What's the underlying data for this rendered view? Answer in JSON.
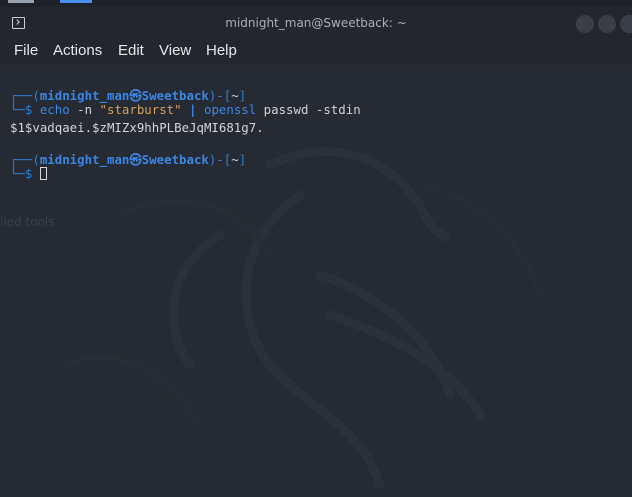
{
  "window": {
    "title": "midnight_man@Sweetback: ~"
  },
  "menu": {
    "items": [
      "File",
      "Actions",
      "Edit",
      "View",
      "Help"
    ]
  },
  "background_ghost_text": "lled tools",
  "prompt1": {
    "open": "┌──(",
    "user_host": "midnight_man㉿Sweetback",
    "mid": ")-[",
    "path": "~",
    "close": "]",
    "arrow": "└─$ ",
    "cmd1": "echo",
    "arg1": " -n ",
    "string": "\"starburst\"",
    "pipe": " | ",
    "cmd2": "openssl",
    "arg2": " passwd ",
    "arg3": "-stdin"
  },
  "output_line": "$1$vadqaei.$zMIZx9hhPLBeJqMI681g7.",
  "prompt2": {
    "open": "┌──(",
    "user_host": "midnight_man㉿Sweetback",
    "mid": ")-[",
    "path": "~",
    "close": "]",
    "arrow": "└─$ "
  },
  "colors": {
    "prompt_blue": "#2e7fd6",
    "string_orange": "#d6a05a",
    "background": "#252a33"
  }
}
